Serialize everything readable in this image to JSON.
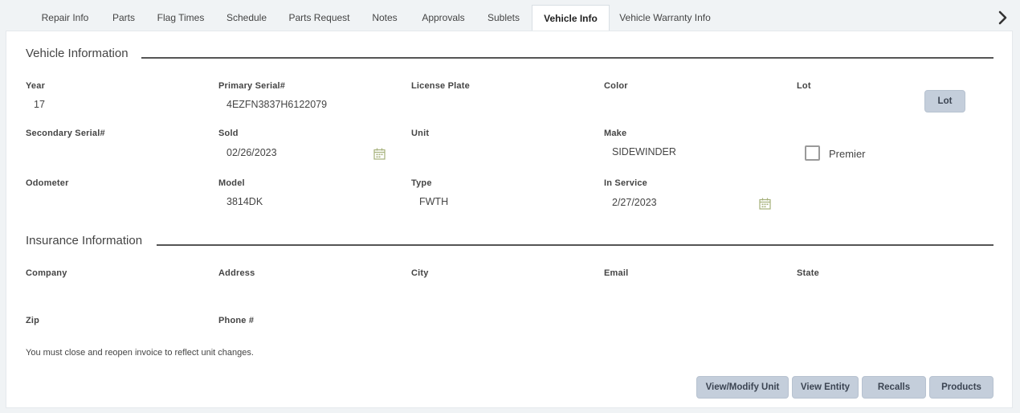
{
  "tabs": {
    "repair_info": "Repair Info",
    "parts": "Parts",
    "flag_times": "Flag Times",
    "schedule": "Schedule",
    "parts_request": "Parts Request",
    "notes": "Notes",
    "approvals": "Approvals",
    "sublets": "Sublets",
    "vehicle_info": "Vehicle Info",
    "vehicle_warranty_info": "Vehicle Warranty Info",
    "active": "Vehicle Info"
  },
  "vehicle": {
    "section_title": "Vehicle Information",
    "year_label": "Year",
    "year_value": "17",
    "primary_serial_label": "Primary Serial#",
    "primary_serial_value": "4EZFN3837H6122079",
    "license_plate_label": "License Plate",
    "license_plate_value": "",
    "color_label": "Color",
    "color_value": "",
    "lot_label": "Lot",
    "lot_button": "Lot",
    "secondary_serial_label": "Secondary Serial#",
    "secondary_serial_value": "",
    "sold_label": "Sold",
    "sold_value": "02/26/2023",
    "unit_label": "Unit",
    "unit_value": "",
    "make_label": "Make",
    "make_value": "SIDEWINDER",
    "premier_label": "Premier",
    "premier_checked": false,
    "odometer_label": "Odometer",
    "odometer_value": "",
    "model_label": "Model",
    "model_value": "3814DK",
    "type_label": "Type",
    "type_value": "FWTH",
    "in_service_label": "In Service",
    "in_service_value": "2/27/2023"
  },
  "insurance": {
    "section_title": "Insurance Information",
    "company_label": "Company",
    "address_label": "Address",
    "city_label": "City",
    "email_label": "Email",
    "state_label": "State",
    "zip_label": "Zip",
    "phone_label": "Phone #"
  },
  "note": "You must close and reopen invoice to reflect unit changes.",
  "actions": {
    "view_modify_unit": "View/Modify Unit",
    "view_entity": "View Entity",
    "recalls": "Recalls",
    "products": "Products"
  },
  "colors": {
    "button_bg": "#c4cedb",
    "calendar_icon": "#a5b07a"
  },
  "icons": {
    "tabs_next": "chevron-right-icon",
    "date_picker": "calendar-icon"
  }
}
